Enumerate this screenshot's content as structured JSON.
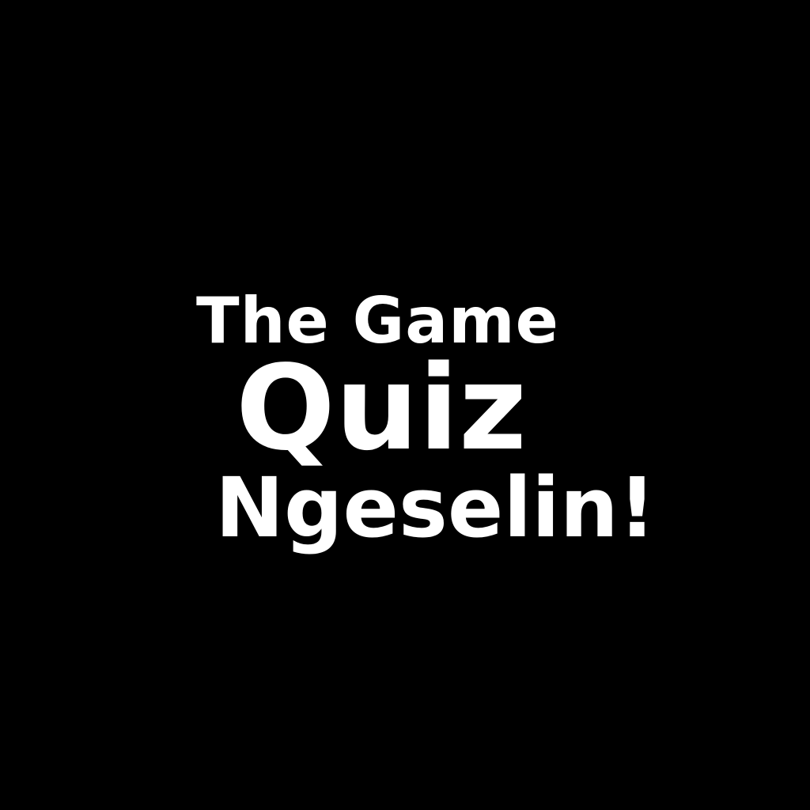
{
  "title_card": {
    "line_1": "The Game",
    "line_2": "Quiz",
    "line_3": "Ngeselin!"
  },
  "colors": {
    "background": "#000000",
    "text": "#ffffff"
  }
}
